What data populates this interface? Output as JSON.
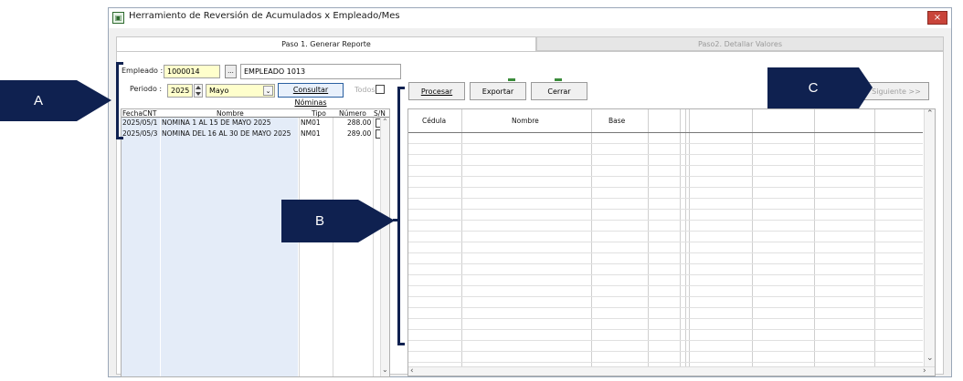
{
  "window": {
    "title": "Herramiento de Reversión de Acumulados x Empleado/Mes",
    "close_icon": "×"
  },
  "tabs": [
    {
      "label": "Paso 1. Generar Reporte"
    },
    {
      "label": "Paso2. Detallar Valores"
    }
  ],
  "form": {
    "empleado_label": "Empleado :",
    "empleado_value": "1000014",
    "lookup_label": "...",
    "empleado_name": "EMPLEADO 1013",
    "periodo_label": "Periodo :",
    "year_value": "2025",
    "month_value": "Mayo",
    "consultar_label": "Consultar Nóminas",
    "todos_label": "Todos"
  },
  "left_table": {
    "headers": [
      "FechaCNT",
      "Nombre",
      "Tipo",
      "Número",
      "S/N"
    ],
    "rows": [
      {
        "fecha": "2025/05/1",
        "nombre": "NOMINA 1 AL 15 DE MAYO 2025",
        "tipo": "NM01",
        "numero": "288.00"
      },
      {
        "fecha": "2025/05/3",
        "nombre": "NOMINA DEL 16 AL 30 DE MAYO 2025",
        "tipo": "NM01",
        "numero": "289.00"
      }
    ]
  },
  "toolbar": {
    "procesar": "Procesar",
    "exportar": "Exportar",
    "cerrar": "Cerrar",
    "siguiente": "Siguiente >>"
  },
  "right_table": {
    "headers": [
      "Cédula",
      "Nombre",
      "Base"
    ]
  },
  "callouts": {
    "a": "A",
    "b": "B",
    "c": "C"
  },
  "colors": {
    "callout": "#0f2150",
    "input_yellow": "#ffffcc",
    "selection_blue": "#e4ecf8",
    "close_red": "#c9443a"
  }
}
